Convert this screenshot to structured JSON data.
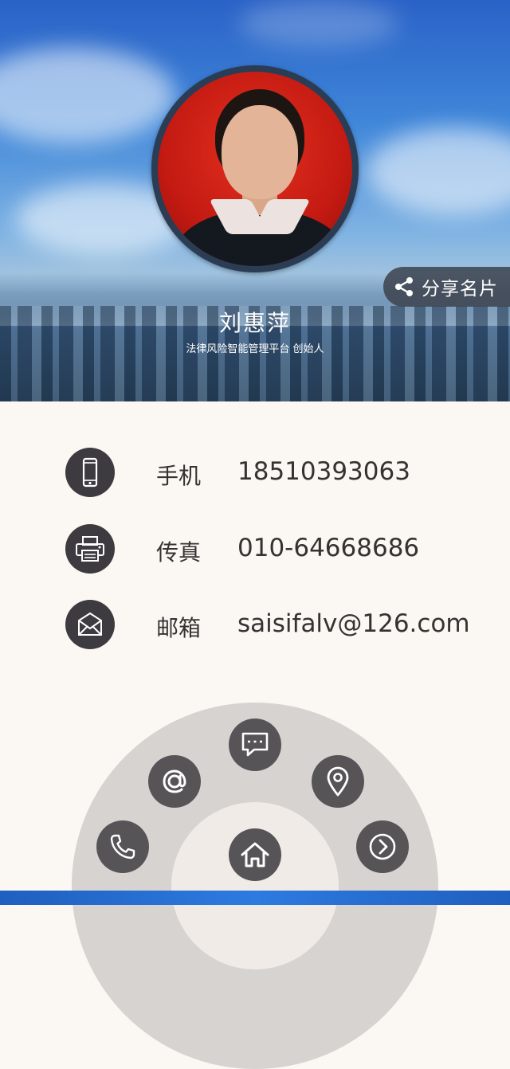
{
  "profile": {
    "name": "刘惠萍",
    "title": "法律风险智能管理平台 创始人",
    "share_label": "分享名片"
  },
  "contacts": [
    {
      "icon": "mobile-phone-icon",
      "label": "手机",
      "value": "18510393063"
    },
    {
      "icon": "fax-printer-icon",
      "label": "传真",
      "value": "010-64668686"
    },
    {
      "icon": "mail-icon",
      "label": "邮箱",
      "value": "saisifalv@126.com"
    }
  ],
  "menu": {
    "items": [
      "phone-call-icon",
      "at-sign-icon",
      "message-icon",
      "location-icon",
      "next-arrow-icon",
      "home-icon"
    ]
  },
  "colors": {
    "icon_bg": "#3d3b3f",
    "menu_button": "#565457",
    "dial": "#d6d3d0",
    "page_bg": "#fbf7f2",
    "bottom_bar": "#2d7be0"
  }
}
